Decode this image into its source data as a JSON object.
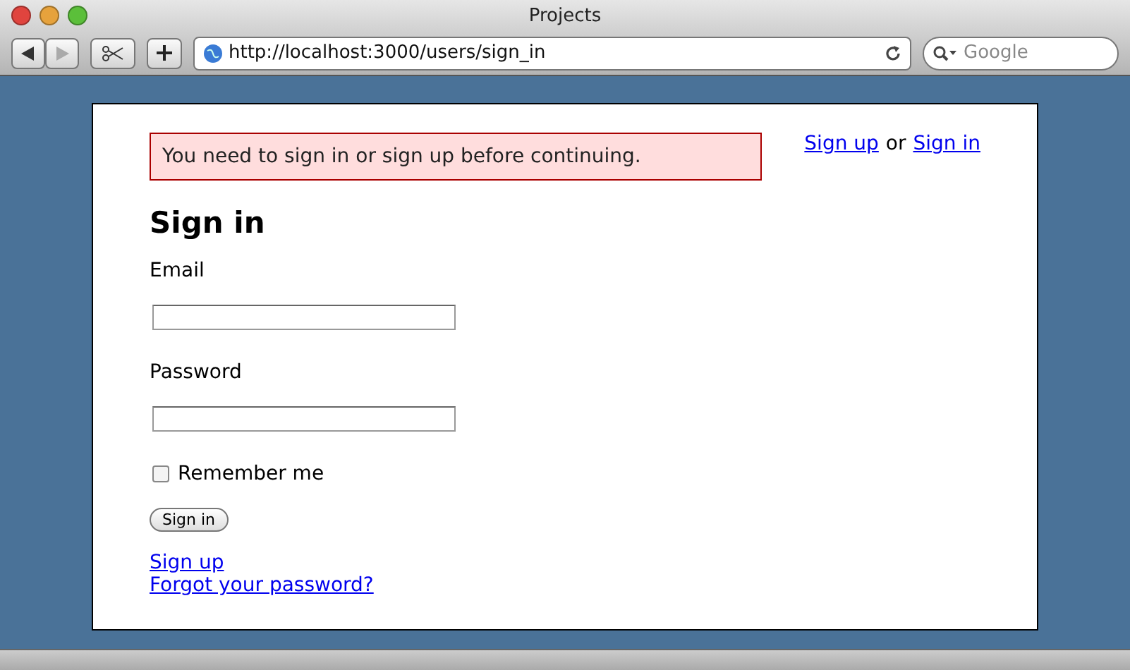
{
  "window": {
    "title": "Projects"
  },
  "toolbar": {
    "url": "http://localhost:3000/users/sign_in",
    "search": {
      "placeholder": "Google"
    }
  },
  "page": {
    "flash": "You need to sign in or sign up before continuing.",
    "user_nav": {
      "first_link": "Sign up",
      "separator": "or",
      "second_link": "Sign in"
    },
    "heading": "Sign in",
    "fields": [
      {
        "label": "Email"
      },
      {
        "label": "Password"
      }
    ],
    "remember": {
      "label": "Remember me",
      "checked": false
    },
    "submit": "Sign in",
    "links": [
      "Sign up",
      "Forgot your password?"
    ]
  }
}
